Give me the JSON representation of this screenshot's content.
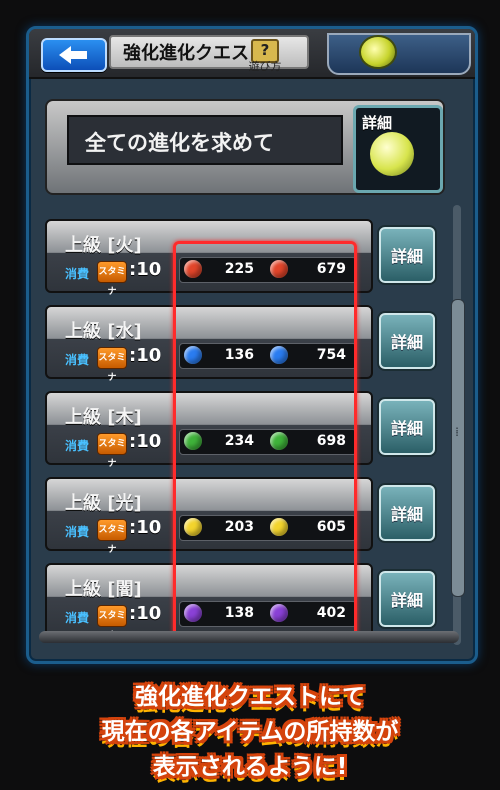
{
  "header": {
    "title": "強化進化クエスト",
    "help_icon": "?",
    "help_label": "遊び方"
  },
  "banner": {
    "text": "全ての進化を求めて",
    "detail_label": "詳細"
  },
  "quests": [
    {
      "name": "上級 [火]",
      "cost_label": "消費",
      "stamina_label": "スタミナ",
      "cost_value": ":10",
      "qty_small": "225",
      "qty_large": "679",
      "orb_color": "#e2452a",
      "detail_label": "詳細"
    },
    {
      "name": "上級 [水]",
      "cost_label": "消費",
      "stamina_label": "スタミナ",
      "cost_value": ":10",
      "qty_small": "136",
      "qty_large": "754",
      "orb_color": "#2a7cf0",
      "detail_label": "詳細"
    },
    {
      "name": "上級 [木]",
      "cost_label": "消費",
      "stamina_label": "スタミナ",
      "cost_value": ":10",
      "qty_small": "234",
      "qty_large": "698",
      "orb_color": "#3fb33a",
      "detail_label": "詳細"
    },
    {
      "name": "上級 [光]",
      "cost_label": "消費",
      "stamina_label": "スタミナ",
      "cost_value": ":10",
      "qty_small": "203",
      "qty_large": "605",
      "orb_color": "#f3d42d",
      "detail_label": "詳細"
    },
    {
      "name": "上級 [闇]",
      "cost_label": "消費",
      "stamina_label": "スタミナ",
      "cost_value": ":10",
      "qty_small": "138",
      "qty_large": "402",
      "orb_color": "#8a41d6",
      "detail_label": "詳細"
    }
  ],
  "caption": {
    "line1": "強化進化クエストにて",
    "line2": "現在の各アイテムの所持数が",
    "line3": "表示されるように!"
  },
  "colors": {
    "frame_border": "#1b5d8c",
    "highlight": "#ff2b2b",
    "caption_outline": "#d4430c"
  }
}
